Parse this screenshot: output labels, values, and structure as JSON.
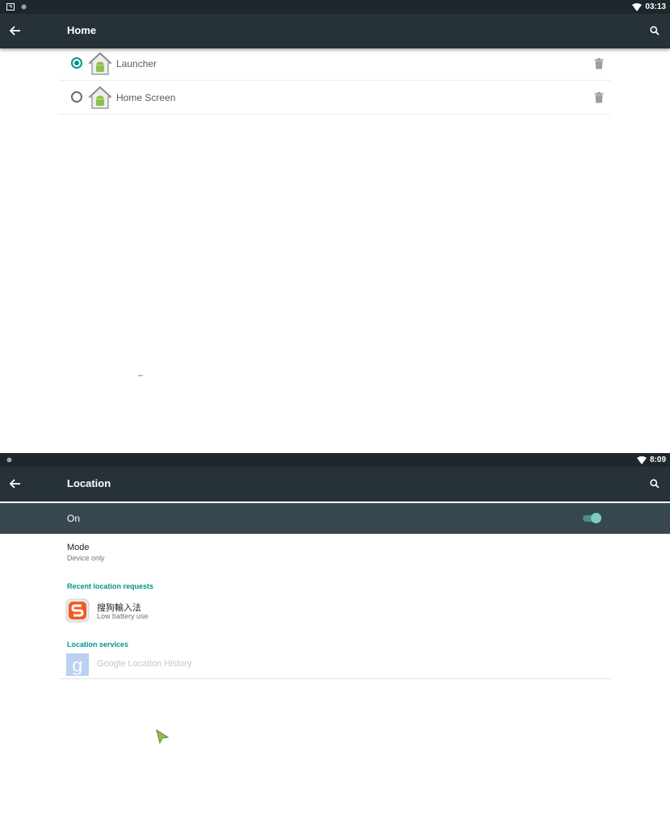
{
  "home_screen": {
    "status_bar": {
      "time": "03:13"
    },
    "app_bar": {
      "title": "Home"
    },
    "apps": [
      {
        "label": "Launcher",
        "selected": true
      },
      {
        "label": "Home Screen",
        "selected": false
      }
    ]
  },
  "location_screen": {
    "status_bar": {
      "time": "8:09"
    },
    "app_bar": {
      "title": "Location"
    },
    "master_switch": {
      "label": "On",
      "state": "on"
    },
    "mode": {
      "title": "Mode",
      "value": "Device only"
    },
    "recent_requests": {
      "header": "Recent location requests",
      "apps": [
        {
          "name": "搜狗輸入法",
          "detail": "Low battery use"
        }
      ]
    },
    "location_services": {
      "header": "Location services",
      "items": [
        {
          "name": "Google Location History",
          "enabled": false
        }
      ]
    }
  },
  "colors": {
    "status_bar": "#1e272c",
    "app_bar": "#263238",
    "switch_bar": "#37474f",
    "accent": "#009688"
  }
}
